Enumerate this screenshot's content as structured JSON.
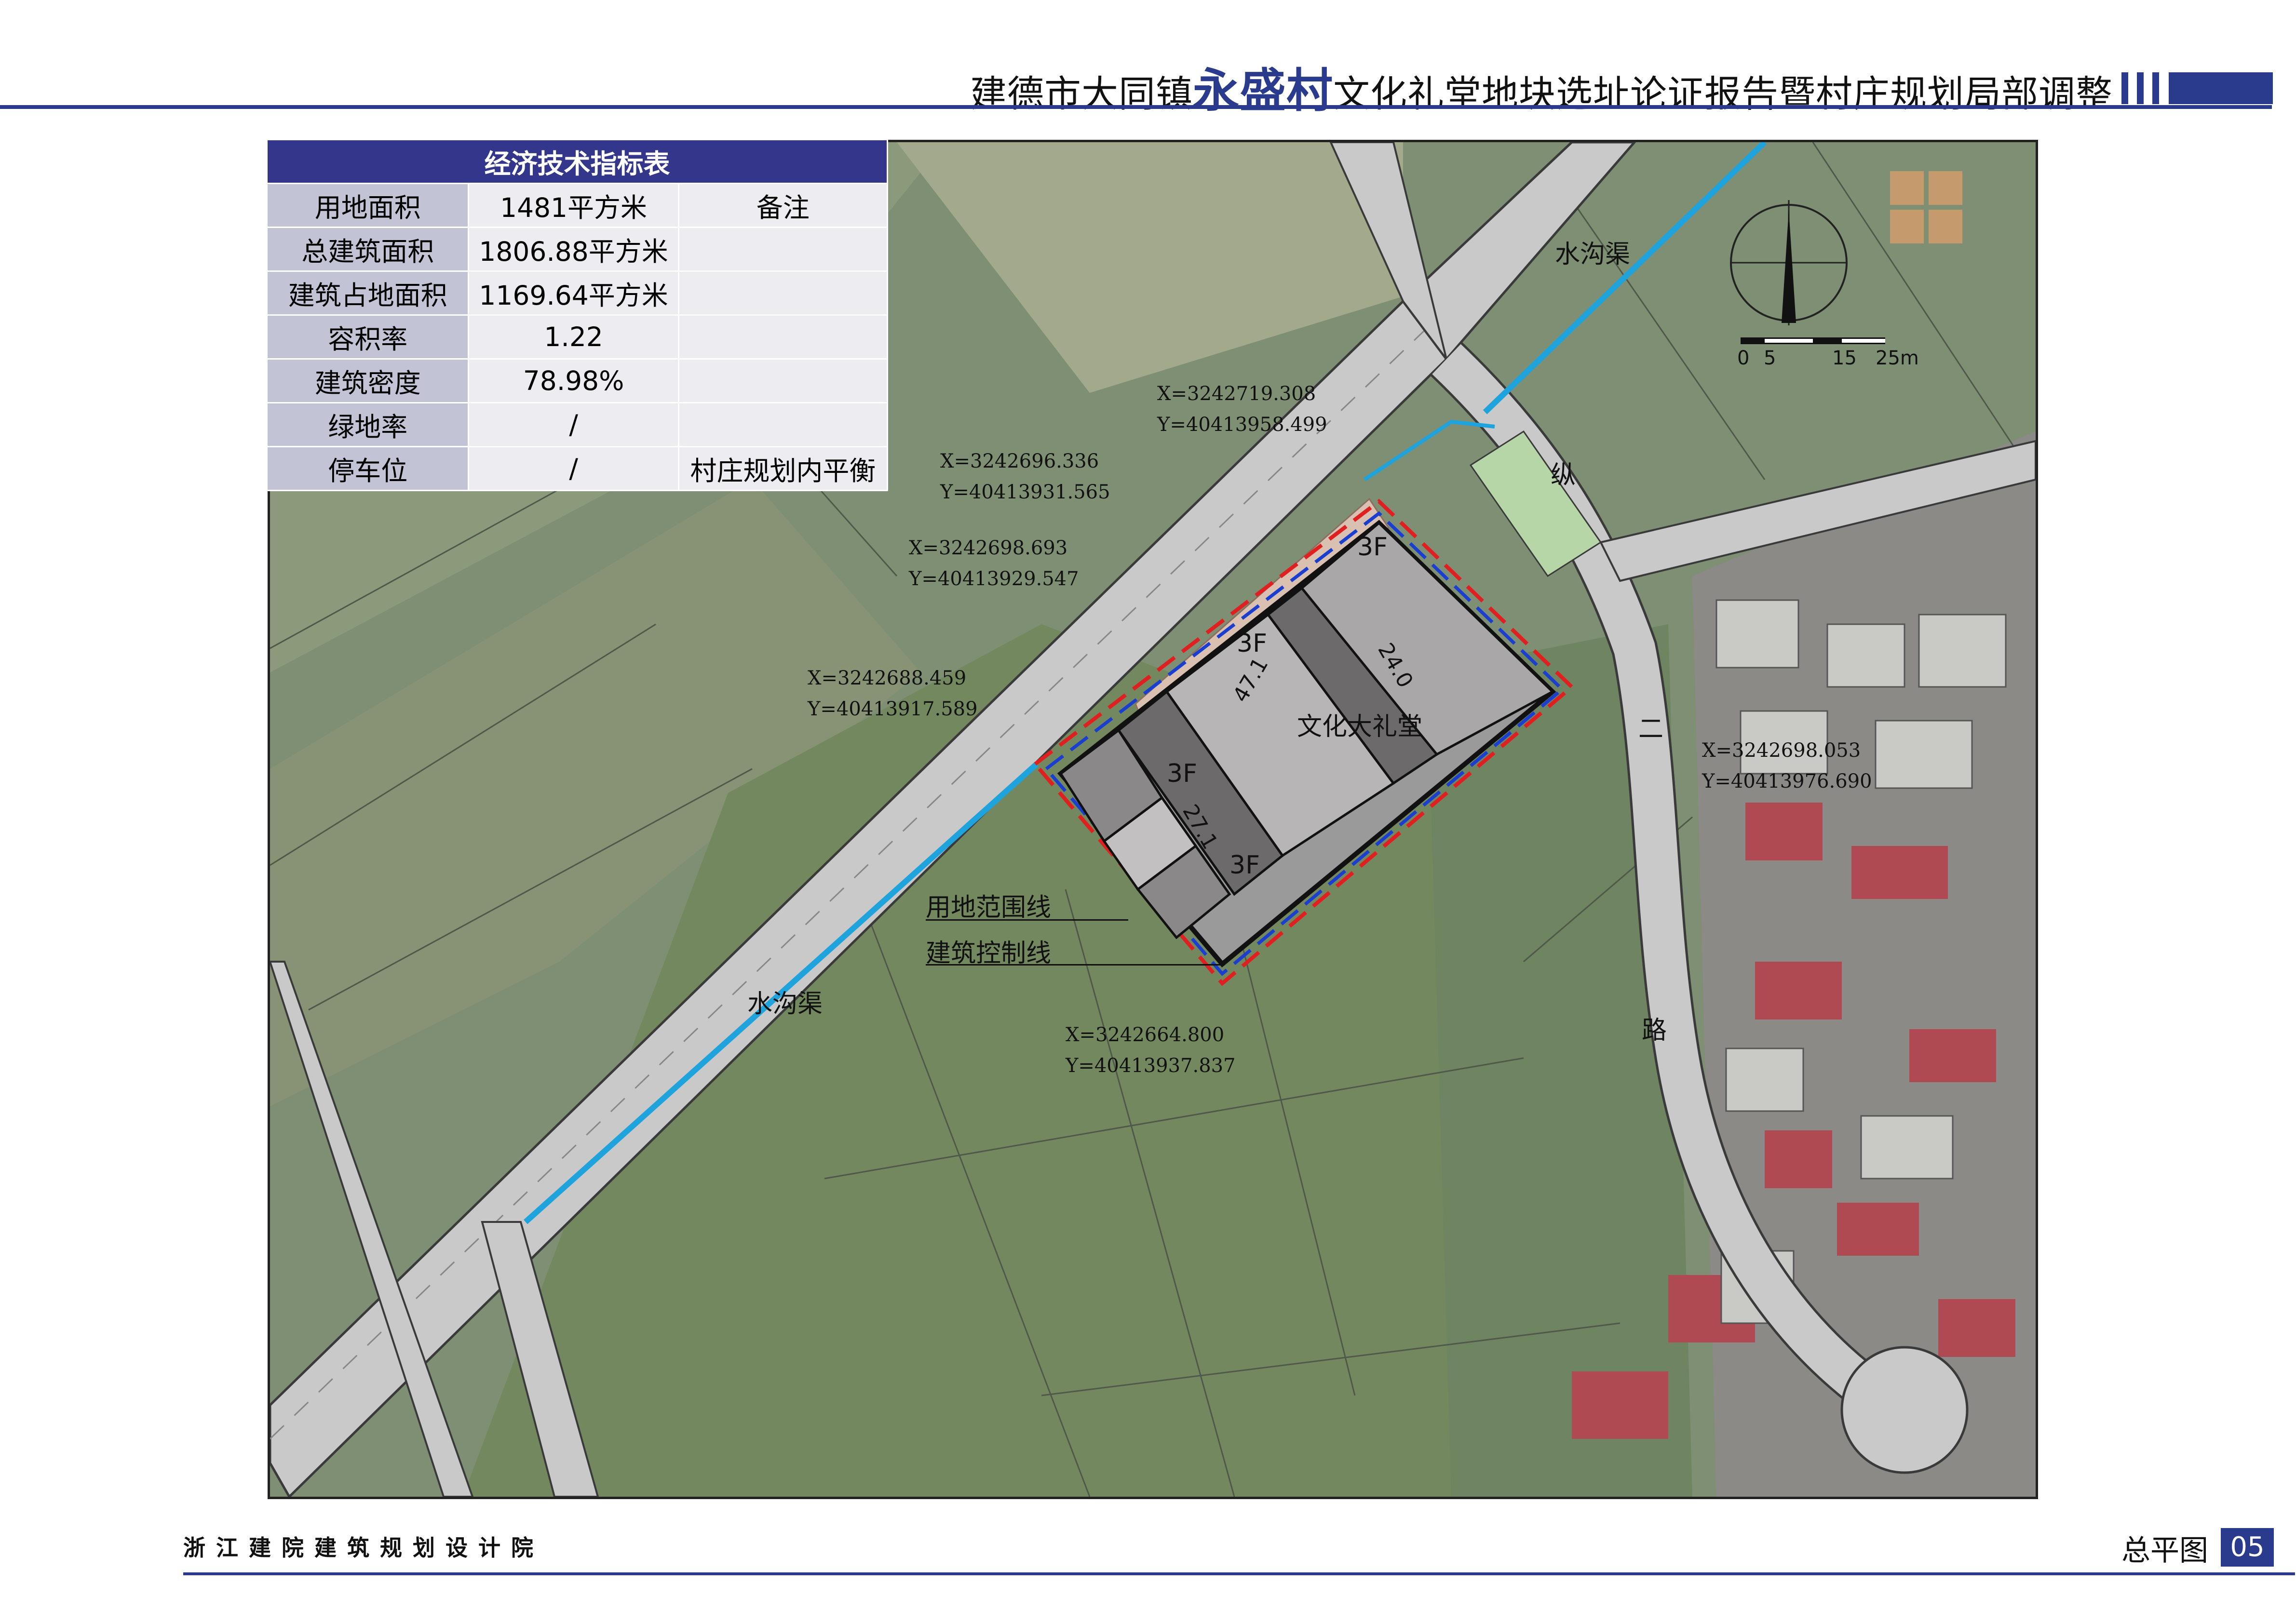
{
  "header": {
    "title_prefix": "建德市大同镇",
    "title_highlight": "永盛村",
    "title_suffix": "文化礼堂地块选址论证报告暨村庄规划局部调整"
  },
  "table": {
    "title": "经济技术指标表",
    "rows": [
      {
        "label": "用地面积",
        "value": "1481平方米",
        "note": "备注"
      },
      {
        "label": "总建筑面积",
        "value": "1806.88平方米",
        "note": ""
      },
      {
        "label": "建筑占地面积",
        "value": "1169.64平方米",
        "note": ""
      },
      {
        "label": "容积率",
        "value": "1.22",
        "note": ""
      },
      {
        "label": "建筑密度",
        "value": "78.98%",
        "note": ""
      },
      {
        "label": "绿地率",
        "value": "/",
        "note": ""
      },
      {
        "label": "停车位",
        "value": "/",
        "note": "村庄规划内平衡"
      }
    ]
  },
  "map": {
    "canal_labels": [
      "水沟渠",
      "水沟渠"
    ],
    "road_chars": [
      "纵",
      "二",
      "路"
    ],
    "building_name": "文化大礼堂",
    "floor_labels": [
      "3F",
      "3F",
      "3F",
      "3F"
    ],
    "dimension_labels": [
      "47.1",
      "24.0",
      "27.1"
    ],
    "legend": {
      "boundary": "用地范围线",
      "control": "建筑控制线"
    },
    "coords": [
      {
        "x": "X=3242719.308",
        "y": "Y=40413958.499"
      },
      {
        "x": "X=3242696.336",
        "y": "Y=40413931.565"
      },
      {
        "x": "X=3242698.693",
        "y": "Y=40413929.547"
      },
      {
        "x": "X=3242688.459",
        "y": "Y=40413917.589"
      },
      {
        "x": "X=3242698.053",
        "y": "Y=40413976.690"
      },
      {
        "x": "X=3242664.800",
        "y": "Y=40413937.837"
      }
    ],
    "scale": {
      "labels": [
        "0",
        "5",
        "15",
        "25m"
      ]
    },
    "colors": {
      "boundary": "#e02020",
      "control": "#1a3fd0",
      "canal": "#1ea3dc",
      "building": "#9a9a9a"
    }
  },
  "footer": {
    "organization": "浙江建院建筑规划设计院",
    "page_title": "总平图",
    "page_number": "05"
  }
}
